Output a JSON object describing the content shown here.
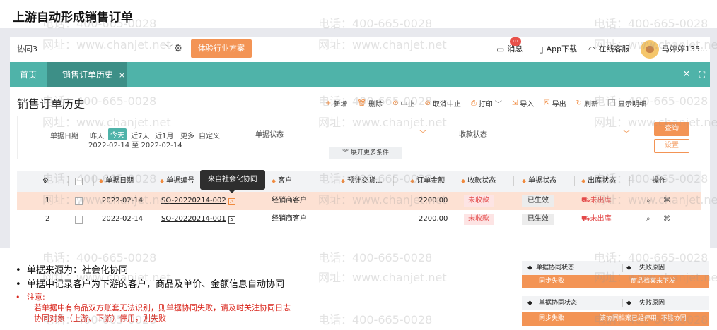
{
  "slide_title": "上游自动形成销售订单",
  "watermarks": {
    "phone": "电话：400-665-0028",
    "site": "网址：www.chanjet.net"
  },
  "topbar": {
    "org_select": "协同3",
    "industry_button": "体验行业方案",
    "message_label": "消息",
    "message_badge": "···",
    "app_download": "App下载",
    "online_service": "在线客服",
    "user_name": "马婷婷135..."
  },
  "tabs": {
    "home": "首页",
    "active": "销售订单历史",
    "active_close": "×"
  },
  "page": {
    "title": "销售订单历史",
    "toolbar": [
      {
        "icon": "add-icon",
        "glyph": "+",
        "label": "新增"
      },
      {
        "icon": "trash-icon",
        "glyph": "🗑",
        "label": "删除"
      },
      {
        "icon": "stop-icon",
        "glyph": "⊘",
        "label": "中止"
      },
      {
        "icon": "cancel-stop-icon",
        "glyph": "⊘",
        "label": "取消中止"
      },
      {
        "icon": "print-icon",
        "glyph": "⎙",
        "label": "打印"
      },
      {
        "icon": "import-icon",
        "glyph": "⇲",
        "label": "导入"
      },
      {
        "icon": "export-icon",
        "glyph": "⇱",
        "label": "导出"
      },
      {
        "icon": "refresh-icon",
        "glyph": "↻",
        "label": "刷新"
      }
    ],
    "show_detail": "显示明细"
  },
  "filter": {
    "date_label": "单据日期",
    "date_options": [
      "昨天",
      "今天",
      "近7天",
      "近1月",
      "更多",
      "自定义"
    ],
    "date_range": "2022-02-14 至 2022-02-14",
    "status_label": "单据状态",
    "receipt_label": "收款状态",
    "query": "查询",
    "settings": "设置",
    "expand": "展开更多条件"
  },
  "table": {
    "headers": [
      "单据日期",
      "单据编号",
      "客户",
      "预计交货...",
      "订单金额",
      "收款状态",
      "单据状态",
      "出库状态",
      "操作"
    ],
    "rows": [
      {
        "idx": "1",
        "date": "2022-02-14",
        "code": "SO-20220214-002",
        "customer": "经销商客户",
        "amount": "2200.00",
        "receipt": "未收款",
        "status": "已生效",
        "out": "未出库"
      },
      {
        "idx": "2",
        "date": "2022-02-14",
        "code": "SO-20220214-001",
        "customer": "经销商客户",
        "amount": "2200.00",
        "receipt": "未收款",
        "status": "已生效",
        "out": "未出库"
      }
    ],
    "tooltip": "来自社会化协同"
  },
  "notes": {
    "line1": "单据来源为：社会化协同",
    "line2": "单据中记录客户为下游的客户，商品及单价、金额信息自动协同",
    "line3": "注意:",
    "sub1": "若单据中有商品双方账套无法识别，则单据协同失败，请及时关注协同日志",
    "sub2": "协同对象（上游、下游）停用，则失败"
  },
  "mini_tables": [
    {
      "h1": "单据协同状态",
      "h2": "失败原因",
      "v1": "同步失败",
      "v2": "商品档案未下发"
    },
    {
      "h1": "单据协同状态",
      "h2": "失败原因",
      "v1": "同步失败",
      "v2": "该协同档案已经停用, 不能协同"
    }
  ],
  "colors": {
    "teal": "#4fb3a9",
    "teal_dark": "#3d8f87",
    "orange": "#f39455",
    "highlight_row": "#fde1d3",
    "note_red": "#d9261c"
  }
}
